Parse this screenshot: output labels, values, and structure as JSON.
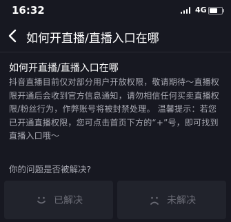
{
  "status_bar": {
    "time": "16:32",
    "network": "4G",
    "battery_level": 0.65
  },
  "nav": {
    "title": "如何开直播/直播入口在哪"
  },
  "article": {
    "title": "如何开直播/直播入口在哪",
    "lines": [
      "抖音直播目前仅对部分用户开放权限，敬请期待～直播权",
      "限开通后会收到官方信息通知，请勿相信任何买卖直播权",
      "限/粉丝行为，作弊账号将被封禁处理。 温馨提示：若您",
      "已开通直播权限，您可点击首页下方的“+”号，即可找到",
      "直播入口哦～"
    ]
  },
  "feedback": {
    "question": "你的问题是否被解决?",
    "resolved_label": "已解决",
    "unresolved_label": "未解决"
  },
  "icons": {
    "back": "chevron-left-icon",
    "resolved": "smile-icon",
    "unresolved": "frown-icon",
    "signal": "signal-icon",
    "battery": "battery-icon"
  },
  "colors": {
    "background": "#171821",
    "button_background": "#21232c",
    "muted_text": "#6b6c76"
  }
}
